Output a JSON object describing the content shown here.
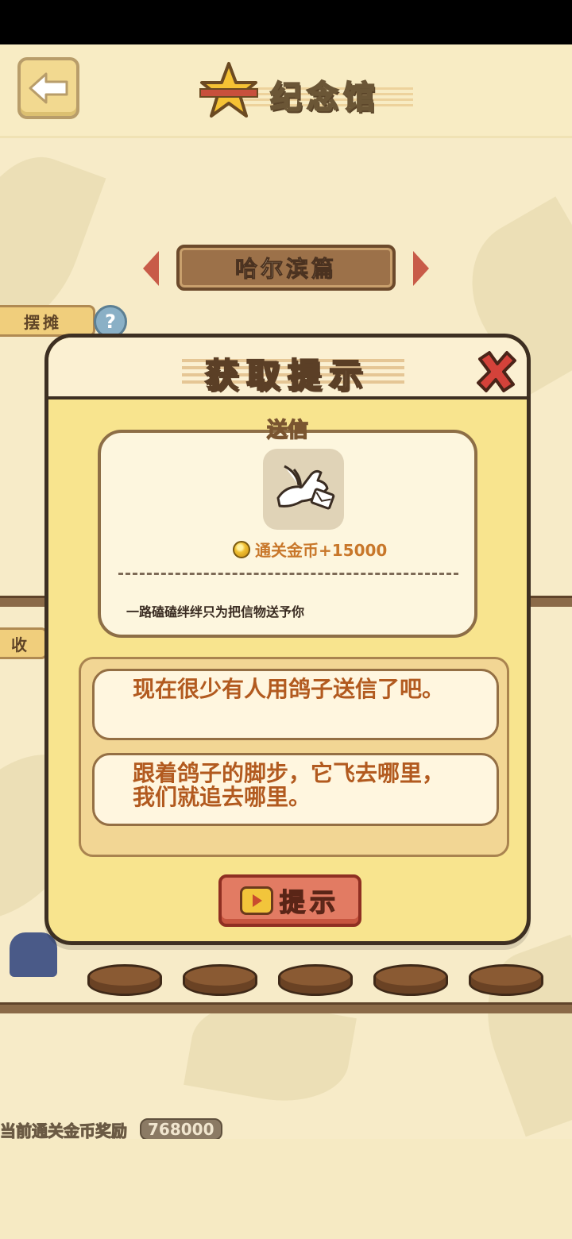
{
  "header": {
    "title": "纪念馆"
  },
  "chapter": {
    "label": "哈尔滨篇"
  },
  "side_tabs": [
    {
      "label": "摆摊"
    },
    {
      "label": "收"
    }
  ],
  "footer": {
    "label": "当前通关金币奖励",
    "value": "768000"
  },
  "modal": {
    "title": "获取提示",
    "item_name": "送信",
    "reward": "通关金币+15000",
    "description": "一路磕磕绊绊只为把信物送予你",
    "hints": [
      "现在很少有人用鸽子送信了吧。",
      "跟着鸽子的脚步，它飞去哪里，我们就追去哪里。"
    ],
    "hint_button": "提示"
  },
  "icons": {
    "back": "back-arrow-icon",
    "close": "close-x-icon",
    "help": "help-question-icon",
    "item": "pigeon-letter-icon",
    "coin": "coin-icon",
    "video": "video-tv-icon"
  },
  "colors": {
    "accent": "#c85b48",
    "panel": "#f8e48e",
    "hint_text": "#b25a1f"
  }
}
